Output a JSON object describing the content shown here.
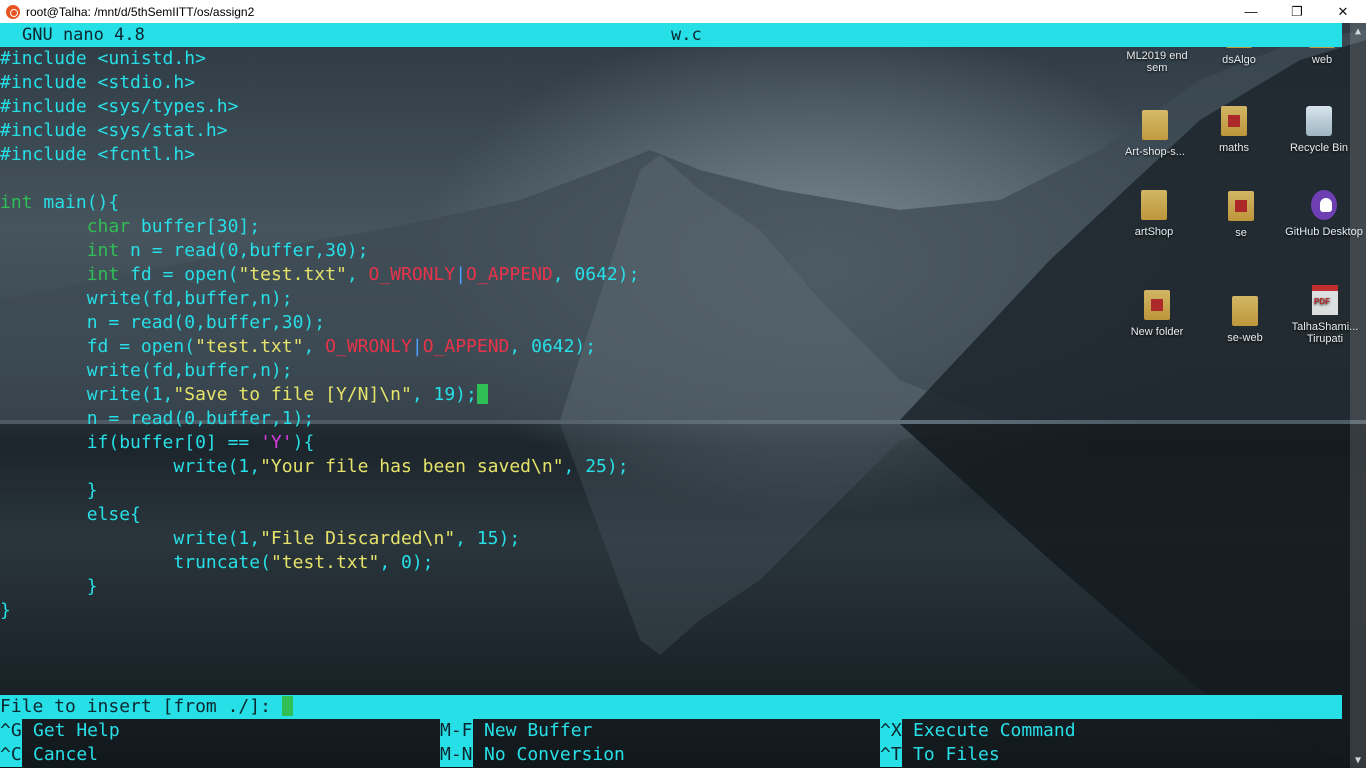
{
  "window": {
    "title": "root@Talha: /mnt/d/5thSemIITT/os/assign2",
    "controls": {
      "minimize": "—",
      "maximize": "❐",
      "close": "✕"
    }
  },
  "nano": {
    "version_label": "GNU nano 4.8",
    "filename": "w.c"
  },
  "code": [
    [
      {
        "t": "#include <unistd.h>",
        "c": "kw-cyan"
      }
    ],
    [
      {
        "t": "#include <stdio.h>",
        "c": "kw-cyan"
      }
    ],
    [
      {
        "t": "#include <sys/types.h>",
        "c": "kw-cyan"
      }
    ],
    [
      {
        "t": "#include <sys/stat.h>",
        "c": "kw-cyan"
      }
    ],
    [
      {
        "t": "#include <fcntl.h>",
        "c": "kw-cyan"
      }
    ],
    [
      {
        "t": "",
        "c": "kw-cyan"
      }
    ],
    [
      {
        "t": "int",
        "c": "kw-green"
      },
      {
        "t": " main(){",
        "c": "kw-cyan"
      }
    ],
    [
      {
        "t": "        ",
        "c": "kw-cyan"
      },
      {
        "t": "char",
        "c": "kw-green"
      },
      {
        "t": " buffer[30];",
        "c": "kw-cyan"
      }
    ],
    [
      {
        "t": "        ",
        "c": "kw-cyan"
      },
      {
        "t": "int",
        "c": "kw-green"
      },
      {
        "t": " n = read(0,buffer,30);",
        "c": "kw-cyan"
      }
    ],
    [
      {
        "t": "        ",
        "c": "kw-cyan"
      },
      {
        "t": "int",
        "c": "kw-green"
      },
      {
        "t": " fd = open(",
        "c": "kw-cyan"
      },
      {
        "t": "\"test.txt\"",
        "c": "str-yellow"
      },
      {
        "t": ", ",
        "c": "kw-cyan"
      },
      {
        "t": "O_WRONLY",
        "c": "macro-red"
      },
      {
        "t": "|",
        "c": "pipe-blue"
      },
      {
        "t": "O_APPEND",
        "c": "macro-red"
      },
      {
        "t": ", 0642);",
        "c": "kw-cyan"
      }
    ],
    [
      {
        "t": "        write(fd,buffer,n);",
        "c": "kw-cyan"
      }
    ],
    [
      {
        "t": "        n = read(0,buffer,30);",
        "c": "kw-cyan"
      }
    ],
    [
      {
        "t": "        fd = open(",
        "c": "kw-cyan"
      },
      {
        "t": "\"test.txt\"",
        "c": "str-yellow"
      },
      {
        "t": ", ",
        "c": "kw-cyan"
      },
      {
        "t": "O_WRONLY",
        "c": "macro-red"
      },
      {
        "t": "|",
        "c": "pipe-blue"
      },
      {
        "t": "O_APPEND",
        "c": "macro-red"
      },
      {
        "t": ", 0642);",
        "c": "kw-cyan"
      }
    ],
    [
      {
        "t": "        write(fd,buffer,n);",
        "c": "kw-cyan"
      }
    ],
    [
      {
        "t": "        write(1,",
        "c": "kw-cyan"
      },
      {
        "t": "\"Save to file [Y/N]\\n\"",
        "c": "str-yellow"
      },
      {
        "t": ", 19);",
        "c": "kw-cyan"
      },
      {
        "t": "",
        "c": "cursor"
      }
    ],
    [
      {
        "t": "        n = read(0,buffer,1);",
        "c": "kw-cyan"
      }
    ],
    [
      {
        "t": "        if(buffer[0] == ",
        "c": "kw-cyan"
      },
      {
        "t": "'Y'",
        "c": "char-mag"
      },
      {
        "t": "){",
        "c": "kw-cyan"
      }
    ],
    [
      {
        "t": "                write(1,",
        "c": "kw-cyan"
      },
      {
        "t": "\"Your file has been saved\\n\"",
        "c": "str-yellow"
      },
      {
        "t": ", 25);",
        "c": "kw-cyan"
      }
    ],
    [
      {
        "t": "        }",
        "c": "kw-cyan"
      }
    ],
    [
      {
        "t": "        else{",
        "c": "kw-cyan"
      }
    ],
    [
      {
        "t": "                write(1,",
        "c": "kw-cyan"
      },
      {
        "t": "\"File Discarded\\n\"",
        "c": "str-yellow"
      },
      {
        "t": ", 15);",
        "c": "kw-cyan"
      }
    ],
    [
      {
        "t": "                truncate(",
        "c": "kw-cyan"
      },
      {
        "t": "\"test.txt\"",
        "c": "str-yellow"
      },
      {
        "t": ", 0);",
        "c": "kw-cyan"
      }
    ],
    [
      {
        "t": "        }",
        "c": "kw-cyan"
      }
    ],
    [
      {
        "t": "}",
        "c": "kw-cyan"
      }
    ]
  ],
  "prompt": {
    "label": "File to insert [from ./]: ",
    "value": ""
  },
  "shortcuts": [
    {
      "key": "^G",
      "label": "Get Help"
    },
    {
      "key": "^C",
      "label": "Cancel"
    },
    {
      "key": "M-F",
      "label": "New Buffer"
    },
    {
      "key": "M-N",
      "label": "No Conversion"
    },
    {
      "key": "^X",
      "label": "Execute Command"
    },
    {
      "key": "^T",
      "label": "To Files"
    }
  ],
  "desktop_icons": [
    {
      "label": "ML2019 end sem",
      "icon": "pdf-icon"
    },
    {
      "label": "dsAlgo",
      "icon": "folder-icon"
    },
    {
      "label": "web",
      "icon": "folder-icon"
    },
    {
      "label": "Art-shop-s...",
      "icon": "folder-icon"
    },
    {
      "label": "maths",
      "icon": "folder-icon"
    },
    {
      "label": "Recycle Bin",
      "icon": "recycle-bin-icon"
    },
    {
      "label": "artShop",
      "icon": "folder-icon"
    },
    {
      "label": "se",
      "icon": "folder-icon"
    },
    {
      "label": "GitHub Desktop",
      "icon": "github-icon"
    },
    {
      "label": "New folder",
      "icon": "folder-icon"
    },
    {
      "label": "se-web",
      "icon": "folder-icon"
    },
    {
      "label": "TalhaShami... Tirupati",
      "icon": "pdf-icon"
    }
  ],
  "colors": {
    "accent_cyan": "#27dfe7",
    "keyword_green": "#2fbf55",
    "string_yellow": "#e6e36a",
    "macro_red": "#e8334a",
    "char_magenta": "#d63ae0"
  }
}
